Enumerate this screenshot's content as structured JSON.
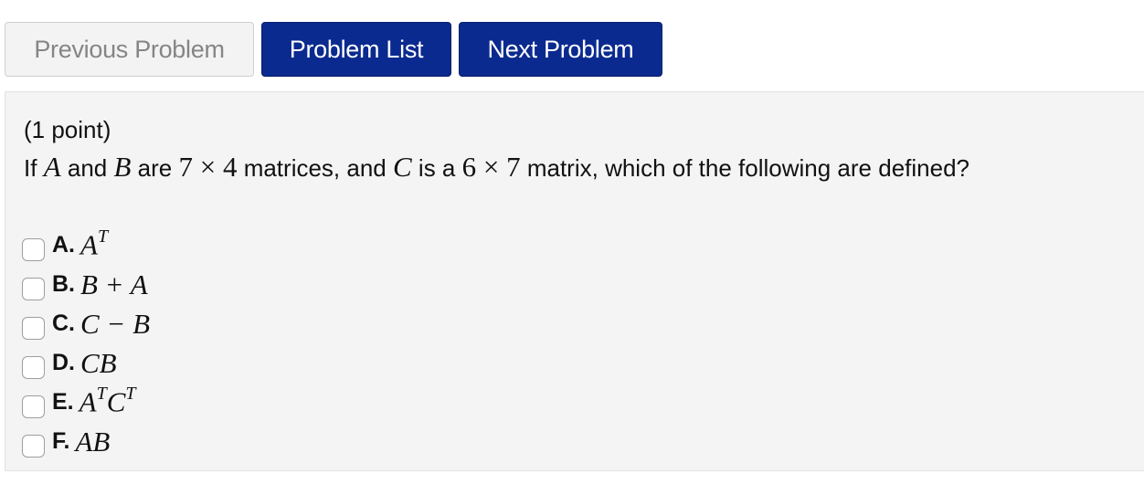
{
  "nav": {
    "previous_label": "Previous Problem",
    "list_label": "Problem List",
    "next_label": "Next Problem"
  },
  "problem": {
    "points": "(1 point)",
    "question": {
      "prefix": "If",
      "var_a": "A",
      "and_text": "and",
      "var_b": "B",
      "are_text": "are",
      "dim1_rows": "7",
      "times1": "×",
      "dim1_cols": "4",
      "mid_text": "matrices, and",
      "var_c": "C",
      "isa_text": "is a",
      "dim2_rows": "6",
      "times2": "×",
      "dim2_cols": "7",
      "suffix": "matrix, which of the following are defined?"
    },
    "options": [
      {
        "letter": "A.",
        "expr": "A",
        "sup": "T"
      },
      {
        "letter": "B.",
        "expr": "B + A"
      },
      {
        "letter": "C.",
        "expr": "C − B"
      },
      {
        "letter": "D.",
        "expr": "CB"
      },
      {
        "letter": "E.",
        "expr1": "A",
        "sup1": "T",
        "expr2": "C",
        "sup2": "T"
      },
      {
        "letter": "F.",
        "expr": "AB"
      }
    ]
  },
  "colors": {
    "primary": "#0b2a8f",
    "panel_bg": "#f4f4f4",
    "disabled_text": "#858585"
  }
}
